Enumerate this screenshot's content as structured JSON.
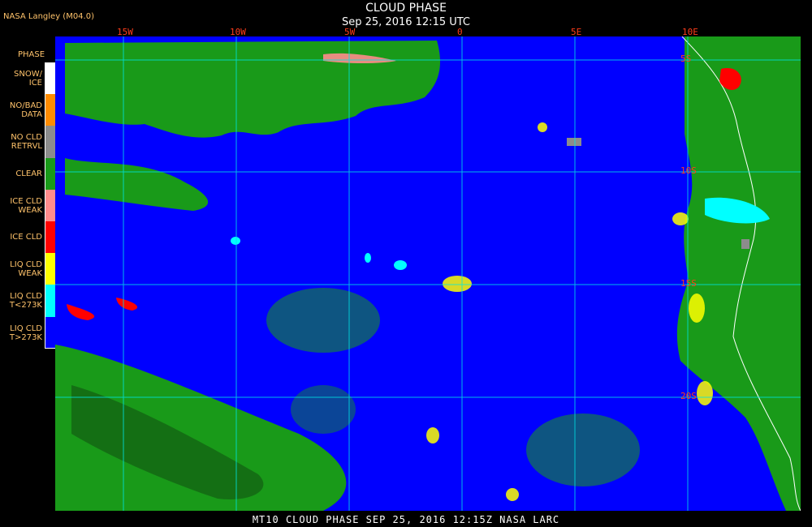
{
  "header": {
    "title": "CLOUD PHASE",
    "subtitle": "Sep 25, 2016 12:15 UTC",
    "badge": "NASA Langley (M04.0)"
  },
  "legend": {
    "title": "PHASE",
    "items": [
      {
        "label_line1": "SNOW/",
        "label_line2": "ICE",
        "color": "#ffffff"
      },
      {
        "label_line1": "NO/BAD",
        "label_line2": "DATA",
        "color": "#ff8c00"
      },
      {
        "label_line1": "NO CLD",
        "label_line2": "RETRVL",
        "color": "#8c8c8c"
      },
      {
        "label_line1": "CLEAR",
        "label_line2": "",
        "color": "#199a19"
      },
      {
        "label_line1": "ICE CLD",
        "label_line2": "WEAK",
        "color": "#ff8c8c"
      },
      {
        "label_line1": "ICE CLD",
        "label_line2": "",
        "color": "#ff0000"
      },
      {
        "label_line1": "LIQ CLD",
        "label_line2": "WEAK",
        "color": "#ffff00"
      },
      {
        "label_line1": "LIQ CLD",
        "label_line2": "T<273K",
        "color": "#00ffff"
      },
      {
        "label_line1": "LIQ CLD",
        "label_line2": "T>273K",
        "color": "#0000ff"
      }
    ]
  },
  "map": {
    "lon_labels": [
      "15W",
      "10W",
      "5W",
      "0",
      "5E",
      "10E"
    ],
    "lat_labels": [
      "5S",
      "10S",
      "15S",
      "20S"
    ],
    "ocean_color": "#0000ff",
    "land_color": "#199a19",
    "grid_color": "#00e5e5"
  },
  "footer": {
    "text": "MT10  CLOUD PHASE  SEP 25, 2016 12:15Z  NASA LARC"
  }
}
